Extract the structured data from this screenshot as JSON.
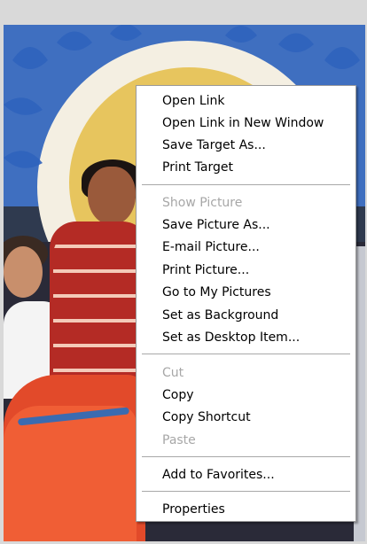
{
  "context_menu": {
    "groups": [
      {
        "items": [
          {
            "label": "Open Link",
            "disabled": false
          },
          {
            "label": "Open Link in New Window",
            "disabled": false
          },
          {
            "label": "Save Target As...",
            "disabled": false
          },
          {
            "label": "Print Target",
            "disabled": false
          }
        ]
      },
      {
        "items": [
          {
            "label": "Show Picture",
            "disabled": true
          },
          {
            "label": "Save Picture As...",
            "disabled": false
          },
          {
            "label": "E-mail Picture...",
            "disabled": false
          },
          {
            "label": "Print Picture...",
            "disabled": false
          },
          {
            "label": "Go to My Pictures",
            "disabled": false
          },
          {
            "label": "Set as Background",
            "disabled": false
          },
          {
            "label": "Set as Desktop Item...",
            "disabled": false
          }
        ]
      },
      {
        "items": [
          {
            "label": "Cut",
            "disabled": true
          },
          {
            "label": "Copy",
            "disabled": false
          },
          {
            "label": "Copy Shortcut",
            "disabled": false
          },
          {
            "label": "Paste",
            "disabled": true
          }
        ]
      },
      {
        "items": [
          {
            "label": "Add to Favorites...",
            "disabled": false
          }
        ]
      },
      {
        "items": [
          {
            "label": "Properties",
            "disabled": false
          }
        ]
      }
    ]
  },
  "colors": {
    "menu_background": "#ffffff",
    "menu_border": "#9a9a9a",
    "disabled_text": "#a7a7a7",
    "enabled_text": "#000000"
  }
}
